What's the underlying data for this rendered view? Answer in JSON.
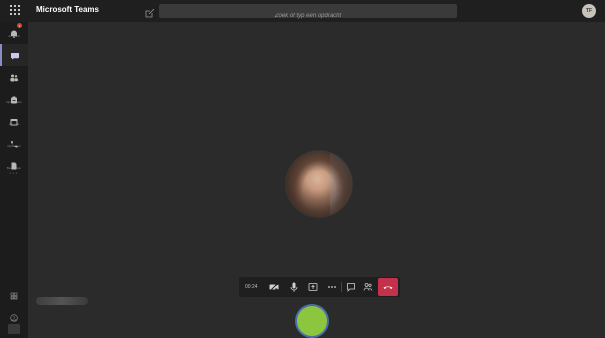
{
  "app": {
    "title": "Microsoft Teams"
  },
  "search": {
    "placeholder": "Zoek of typ een opdracht"
  },
  "user": {
    "initials": "TF"
  },
  "rail": {
    "items": [
      {
        "label": "Activiteit",
        "icon": "bell-icon",
        "badge": "1"
      },
      {
        "label": "Chat",
        "icon": "chat-icon",
        "active": true
      },
      {
        "label": "Teams",
        "icon": "teams-icon"
      },
      {
        "label": "Opdrachten",
        "icon": "assignments-icon"
      },
      {
        "label": "Agenda",
        "icon": "calendar-icon"
      },
      {
        "label": "Oproepen",
        "icon": "phone-icon"
      },
      {
        "label": "Bestanden",
        "icon": "files-icon"
      }
    ],
    "more": "···",
    "bottom": [
      {
        "label": "Apps",
        "icon": "apps-icon"
      },
      {
        "label": "Help",
        "icon": "help-icon"
      }
    ]
  },
  "call": {
    "timer": "00:24",
    "controls": [
      "video-camera-icon",
      "microphone-icon",
      "share-screen-icon",
      "more-icon",
      "chat-icon",
      "participants-icon",
      "hangup-icon"
    ]
  },
  "colors": {
    "accent": "#8b8cc7",
    "hangup": "#c4314b",
    "self_preview": "#8cc63f",
    "background": "#2b2b2b"
  }
}
